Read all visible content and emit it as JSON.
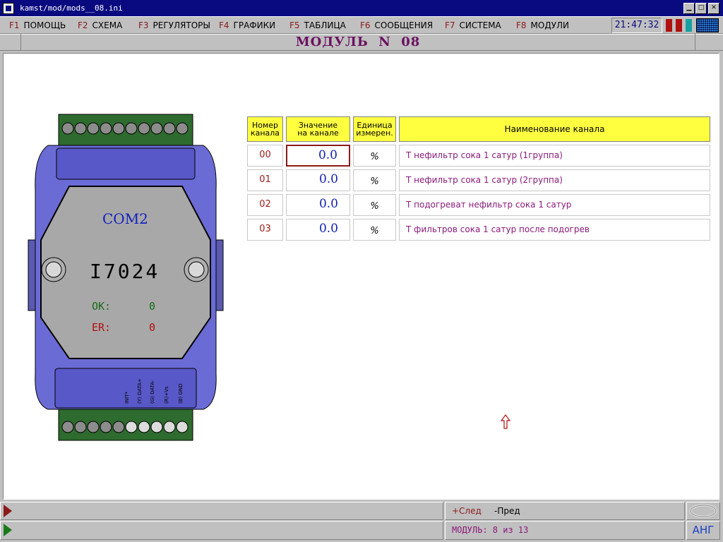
{
  "window": {
    "title": "kamst/mod/mods__08.ini"
  },
  "menu": {
    "items": [
      {
        "key": "F1",
        "label": "ПОМОЩЬ"
      },
      {
        "key": "F2",
        "label": "СХЕМА"
      },
      {
        "key": "F3",
        "label": "РЕГУЛЯТОРЫ"
      },
      {
        "key": "F4",
        "label": "ГРАФИКИ"
      },
      {
        "key": "F5",
        "label": "ТАБЛИЦА"
      },
      {
        "key": "F6",
        "label": "СООБЩЕНИЯ"
      },
      {
        "key": "F7",
        "label": "СИСТЕМА"
      },
      {
        "key": "F8",
        "label": "МОДУЛИ"
      }
    ],
    "clock": "21:47:32"
  },
  "header": {
    "title": "МОДУЛЬ  N  08"
  },
  "device": {
    "port": "COM2",
    "model": "I7024",
    "ok_label": "OK:",
    "ok_value": "0",
    "er_label": "ER:",
    "er_value": "0",
    "pins": [
      "INIT*",
      "(Y) DATA+",
      "(G) DATA-",
      "(R)+Vs",
      "(B) GND"
    ]
  },
  "table": {
    "headers": {
      "num": [
        "Номер",
        "канала"
      ],
      "value": [
        "Значение",
        "на канале"
      ],
      "unit": [
        "Единица",
        "измерен."
      ],
      "name": "Наименование канала"
    },
    "rows": [
      {
        "num": "00",
        "value": "0.0",
        "unit": "%",
        "name": "Т нефильтр сока 1 сатур (1группа)"
      },
      {
        "num": "01",
        "value": "0.0",
        "unit": "%",
        "name": "Т нефильтр сока 1 сатур (2группа)"
      },
      {
        "num": "02",
        "value": "0.0",
        "unit": "%",
        "name": "Т подогреват нефильтр сока 1 сатур"
      },
      {
        "num": "03",
        "value": "0.0",
        "unit": "%",
        "name": "Т фильтров сока 1 сатур после подогрев"
      }
    ]
  },
  "footer": {
    "next_label": "+След",
    "prev_label": "-Пред",
    "module_status": "МОДУЛЬ: 8 из 13",
    "lang": "АНГ"
  },
  "colors": {
    "menu_key": "#8b1a1a",
    "title": "#6a1060",
    "device_body": "#6b6bd6",
    "header_bg": "#ffff40"
  }
}
